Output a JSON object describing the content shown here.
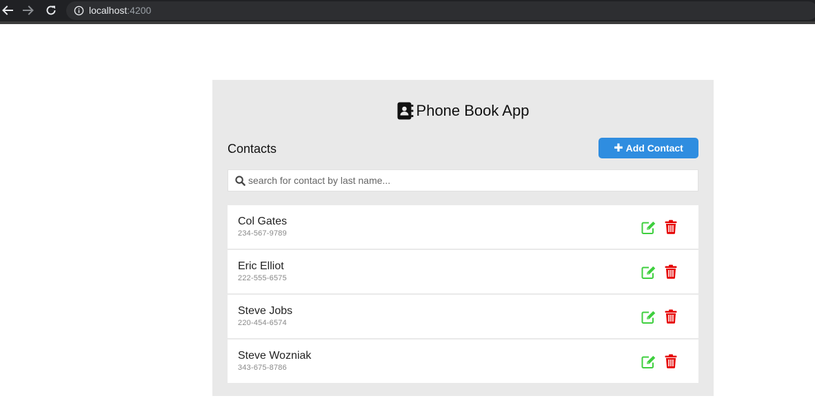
{
  "browser": {
    "url_host": "localhost",
    "url_port": ":4200",
    "icons": [
      "back-arrow-icon",
      "forward-arrow-icon",
      "reload-icon",
      "info-icon"
    ]
  },
  "app": {
    "title": "Phone Book App",
    "title_icon": "address-book-icon",
    "contacts_heading": "Contacts",
    "add_button_label": "Add Contact",
    "add_button_icon": "plus-icon",
    "search": {
      "placeholder": "search for contact by last name...",
      "value": "",
      "icon": "search-icon"
    },
    "contacts": [
      {
        "name": "Col Gates",
        "phone": "234-567-9789"
      },
      {
        "name": "Eric Elliot",
        "phone": "222-555-6575"
      },
      {
        "name": "Steve Jobs",
        "phone": "220-454-6574"
      },
      {
        "name": "Steve Wozniak",
        "phone": "343-675-8786"
      }
    ],
    "colors": {
      "panel_bg": "#e9e9e9",
      "accent": "#2f8de0",
      "edit_green": "#3ecf3e",
      "delete_red": "#e60000"
    }
  }
}
